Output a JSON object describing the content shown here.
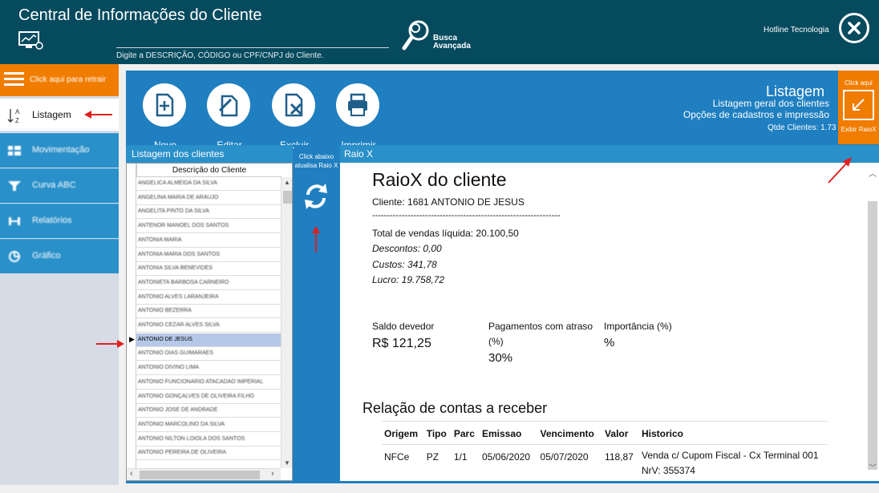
{
  "header": {
    "title": "Central de Informações do Cliente",
    "search_value": "",
    "search_hint": "Digite a DESCRIÇÃO, CÓDIGO ou CPF/CNPJ do Cliente.",
    "busca_label_1": "Busca",
    "busca_label_2": "Avançada",
    "user": "Hotline Tecnologia",
    "close_icon": "close-icon",
    "accent_color": "#064a5e"
  },
  "sidebar": {
    "retrair_label": "Click aqui para retrair",
    "active_label": "Listagem",
    "items": [
      {
        "label": "Movimentação",
        "icon": "movement-icon"
      },
      {
        "label": "Curva ABC",
        "icon": "funnel-icon"
      },
      {
        "label": "Relatórios",
        "icon": "report-icon"
      },
      {
        "label": "Gráfico",
        "icon": "pie-chart-icon"
      }
    ]
  },
  "toolbar": {
    "novo": "Novo",
    "editar": "Editar",
    "excluir": "Excluir",
    "imprimir": "Imprimir",
    "listagem_title": "Listagem",
    "listagem_sub1": "Listagem geral dos clientes",
    "listagem_sub2": "Opções de cadastros e impressão",
    "qtde": "Qtde Clientes: 1.73",
    "raiox_top": "Click aqui",
    "raiox_bottom": "Exibir RaioX"
  },
  "clients": {
    "header": "Listagem dos clientes",
    "column": "Descrição do Cliente",
    "rows": [
      "ANGELICA ALMEIDA DA SILVA",
      "ANGELINA MARIA DE ARAUJO",
      "ANGELITA PINTO DA SILVA",
      "ANTENOR MANOEL DOS SANTOS",
      "ANTONIA MARIA",
      "ANTONIA MARIA DOS SANTOS",
      "ANTONIA SILVA BENEVIDES",
      "ANTONIETA BARBOSA CARNEIRO",
      "ANTONIO ALVES LARANJEIRA",
      "ANTONIO BEZERRA",
      "ANTONIO CEZAR ALVES SILVA",
      "ANTONIO DE JESUS",
      "ANTONIO DIAS GUIMARAES",
      "ANTONIO DIVINO LIMA",
      "ANTONIO FUNCIONARIO ATACADAO IMPERIAL",
      "ANTONIO GONÇALVES DE OLIVEIRA FILHO",
      "ANTONIO JOSE DE ANDRADE",
      "ANTONIO MARCOLINO DA SILVA",
      "ANTONIO NILTON LOIOLA DOS SANTOS",
      "ANTONIO PEREIRA DE OLIVEIRA"
    ],
    "selected_index": 11
  },
  "refresh": {
    "hint": "Click abaixo atualisa Raio X"
  },
  "raiox": {
    "header": "Raio X",
    "title": "RaioX do cliente",
    "cliente": "Cliente: 1681 ANTONIO DE JESUS",
    "separator": "----------------------------------------------------------------",
    "total": "Total de vendas líquida: 20.100,50",
    "descontos": "Descontos: 0,00",
    "custos": "Custos: 341,78",
    "lucro": "Lucro: 19.758,72",
    "saldo_label": "Saldo devedor",
    "saldo_value": "R$ 121,25",
    "atraso_label_1": "Pagamentos com atraso",
    "atraso_label_2": "(%)",
    "atraso_value": "30%",
    "importancia_label": "Importância (%)",
    "importancia_value": "%",
    "relacao_title": "Relação de contas a receber",
    "columns": [
      "Origem",
      "Tipo",
      "Parc",
      "Emissao",
      "Vencimento",
      "Valor",
      "Historico"
    ],
    "rows": [
      [
        "NFCe",
        "PZ",
        "1/1",
        "05/06/2020",
        "05/07/2020",
        "118,87",
        "Venda c/ Cupom Fiscal - Cx Terminal 001 NrV: 355374"
      ]
    ]
  }
}
